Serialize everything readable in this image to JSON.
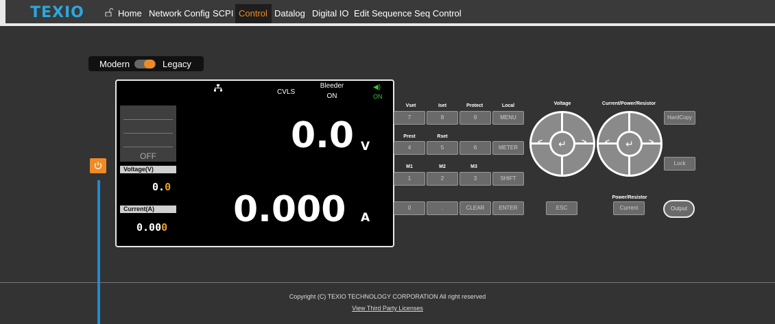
{
  "header": {
    "logo": "TEXIO",
    "nav": [
      "Home",
      "Network Config",
      "SCPI",
      "Control",
      "Datalog",
      "Digital IO",
      "Edit Sequence",
      "Seq Control"
    ],
    "active_tab": "Control",
    "accent_color": "#f08a24",
    "logo_color": "#2aa7df"
  },
  "mode_toggle": {
    "left": "Modern",
    "right": "Legacy"
  },
  "screen": {
    "mode": "CVLS",
    "bleeder_label": "Bleeder",
    "bleeder_state": "ON",
    "sound_state": "ON",
    "output_state": "OFF",
    "voltage_label": "Voltage(V)",
    "voltage_main": "0.",
    "voltage_digit": "0",
    "current_label": "Current(A)",
    "current_main": "0.00",
    "current_digit": "0",
    "big_voltage": "0.0",
    "big_voltage_unit": "V",
    "big_current": "0.000",
    "big_current_unit": "A"
  },
  "keypad": {
    "row1_labels": [
      "Vset",
      "Iset",
      "Protect",
      "Local"
    ],
    "row1_keys": [
      "7",
      "8",
      "9",
      "MENU"
    ],
    "row2_labels": [
      "Prest",
      "Rset"
    ],
    "row2_keys": [
      "4",
      "5",
      "6",
      "METER"
    ],
    "row3_labels": [
      "M1",
      "M2",
      "M3"
    ],
    "row3_keys": [
      "1",
      "2",
      "3",
      "SHIFT"
    ],
    "row4_keys": [
      "0",
      ".",
      "CLEAR",
      "ENTER"
    ],
    "esc": "ESC"
  },
  "dials": {
    "voltage_label": "Voltage",
    "current_label": "Current/Power/Resistor",
    "enter_glyph": "↵"
  },
  "side_buttons": {
    "hardcopy": "HardCopy",
    "lock": "Lock",
    "pr_label": "Power/Resistor",
    "current": "Current",
    "output": "Output"
  },
  "footer": {
    "copyright": "Copyright (C) TEXIO TECHNOLOGY CORPORATION All right reserved",
    "licenses": "View Third Party Licenses"
  }
}
